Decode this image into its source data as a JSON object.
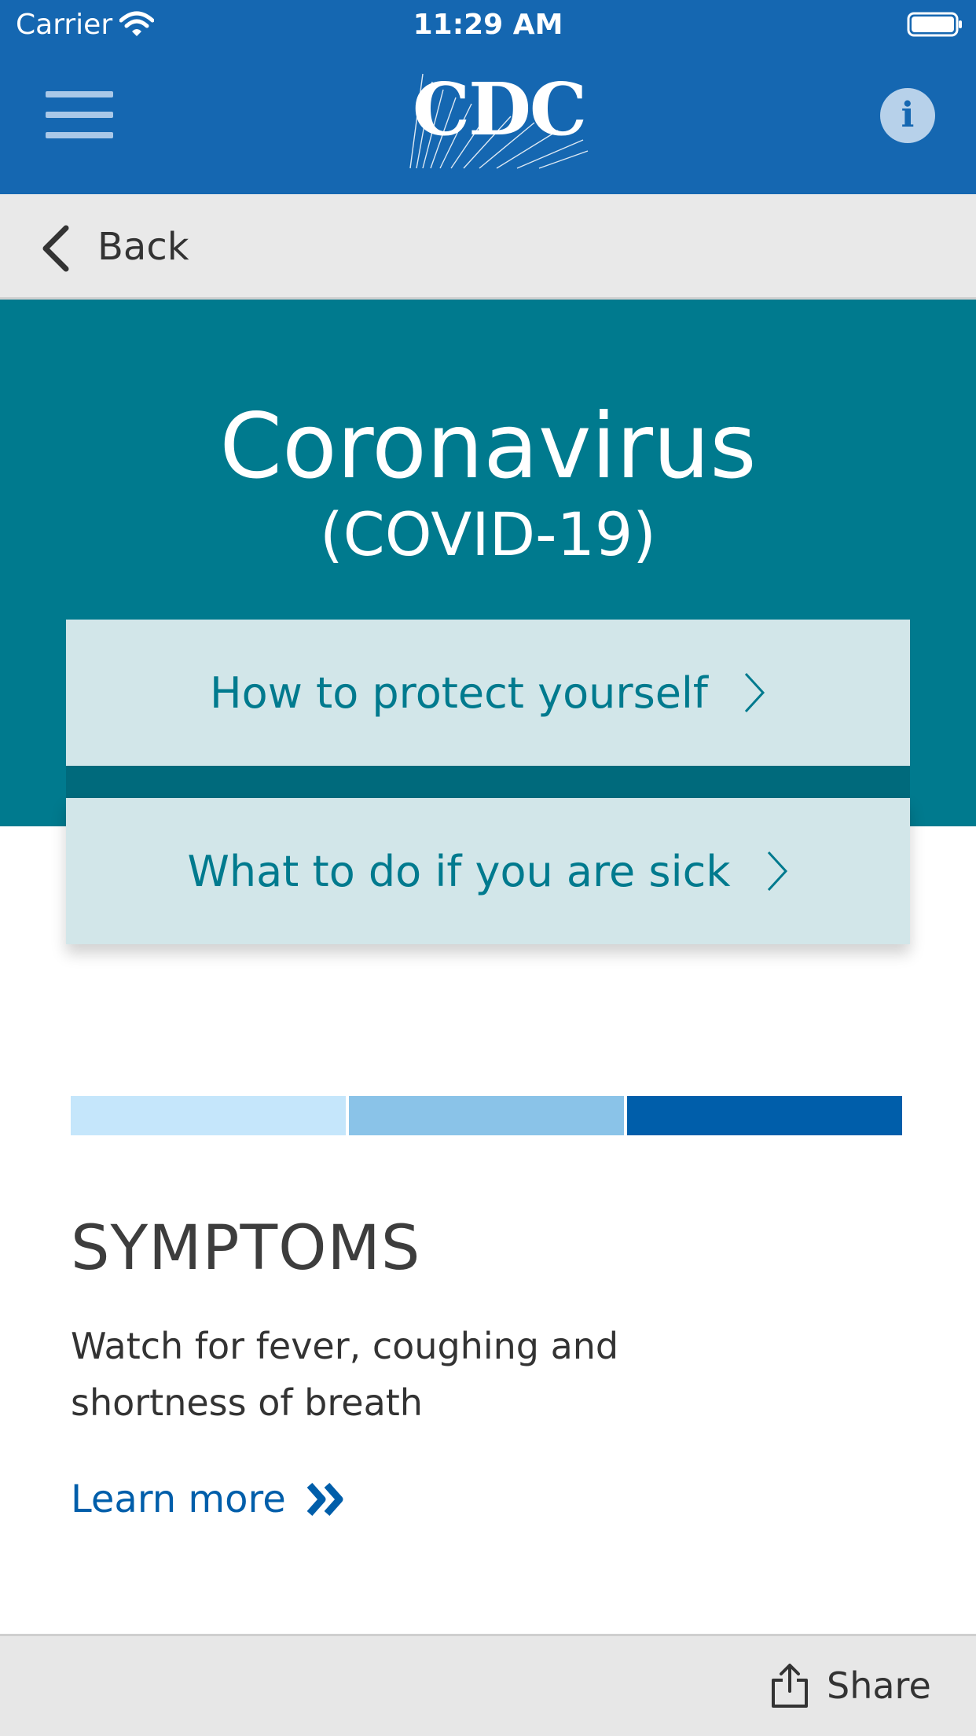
{
  "status_bar": {
    "carrier": "Carrier",
    "time": "11:29 AM"
  },
  "header": {
    "logo_text": "CDC",
    "menu_icon": "hamburger-menu-icon",
    "info_icon": "info-icon",
    "info_glyph": "i",
    "background": "#1567b1"
  },
  "nav": {
    "back_label": "Back"
  },
  "hero": {
    "title": "Coronavirus",
    "subtitle": "(COVID-19)",
    "background": "#007a8e",
    "buttons": [
      {
        "label": "How to protect yourself"
      },
      {
        "label": "What to do if you are sick"
      }
    ]
  },
  "color_bars": [
    "#c5e6fb",
    "#8ac3e8",
    "#005eaa"
  ],
  "symptoms": {
    "title": "SYMPTOMS",
    "body": "Watch for fever, coughing and shortness of breath",
    "link_label": "Learn more"
  },
  "bottom_bar": {
    "share_label": "Share"
  }
}
